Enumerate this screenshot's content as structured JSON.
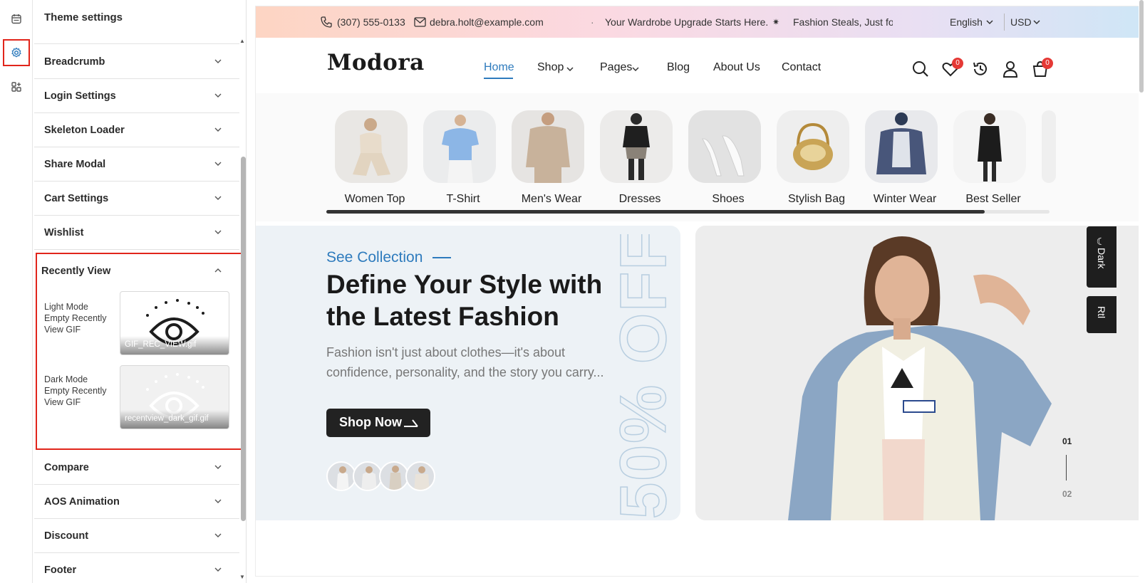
{
  "panel": {
    "title": "Theme settings",
    "sections": [
      {
        "label": "Breadcrumb"
      },
      {
        "label": "Login Settings"
      },
      {
        "label": "Skeleton Loader"
      },
      {
        "label": "Share Modal"
      },
      {
        "label": "Cart Settings"
      },
      {
        "label": "Wishlist"
      },
      {
        "label": "Recently View"
      },
      {
        "label": "Compare"
      },
      {
        "label": "AOS Animation"
      },
      {
        "label": "Discount"
      },
      {
        "label": "Footer"
      }
    ],
    "recently_view": {
      "light_label": "Light Mode Empty Recently View GIF",
      "light_file": "GIF_REC_VIEW.gif",
      "dark_label": "Dark Mode Empty Recently View GIF",
      "dark_file": "recentview_dark_gif.gif"
    }
  },
  "rail": {
    "icons": [
      "calendar-icon",
      "gear-icon",
      "widgets-icon"
    ]
  },
  "topbar": {
    "phone": "(307) 555-0133",
    "email": "debra.holt@example.com",
    "promo1": "Your Wardrobe Upgrade Starts Here.",
    "promo2": "Fashion Steals, Just for Y",
    "language": "English",
    "currency": "USD"
  },
  "nav": {
    "logo": "Modora",
    "menu": [
      "Home",
      "Shop",
      "Pages",
      "Blog",
      "About Us",
      "Contact"
    ],
    "wishlist_count": "0",
    "cart_count": "0"
  },
  "categories": [
    "Women Top",
    "T-Shirt",
    "Men's Wear",
    "Dresses",
    "Shoes",
    "Stylish Bag",
    "Winter Wear",
    "Best Seller"
  ],
  "categories_scroll_progress": 0.91,
  "hero": {
    "kicker": "See Collection",
    "title": "Define Your Style with the Latest Fashion",
    "description": "Fashion isn't just about clothes—it's about confidence, personality, and the story you carry...",
    "button": "Shop Now",
    "discount": "50% OFF",
    "slide_current": "01",
    "slide_next": "02"
  },
  "side_tabs": {
    "dark": "Dark",
    "rtl": "Rtl"
  },
  "colors": {
    "accent": "#2e7bbd",
    "highlight": "#e1251b",
    "badge": "#e53935"
  }
}
